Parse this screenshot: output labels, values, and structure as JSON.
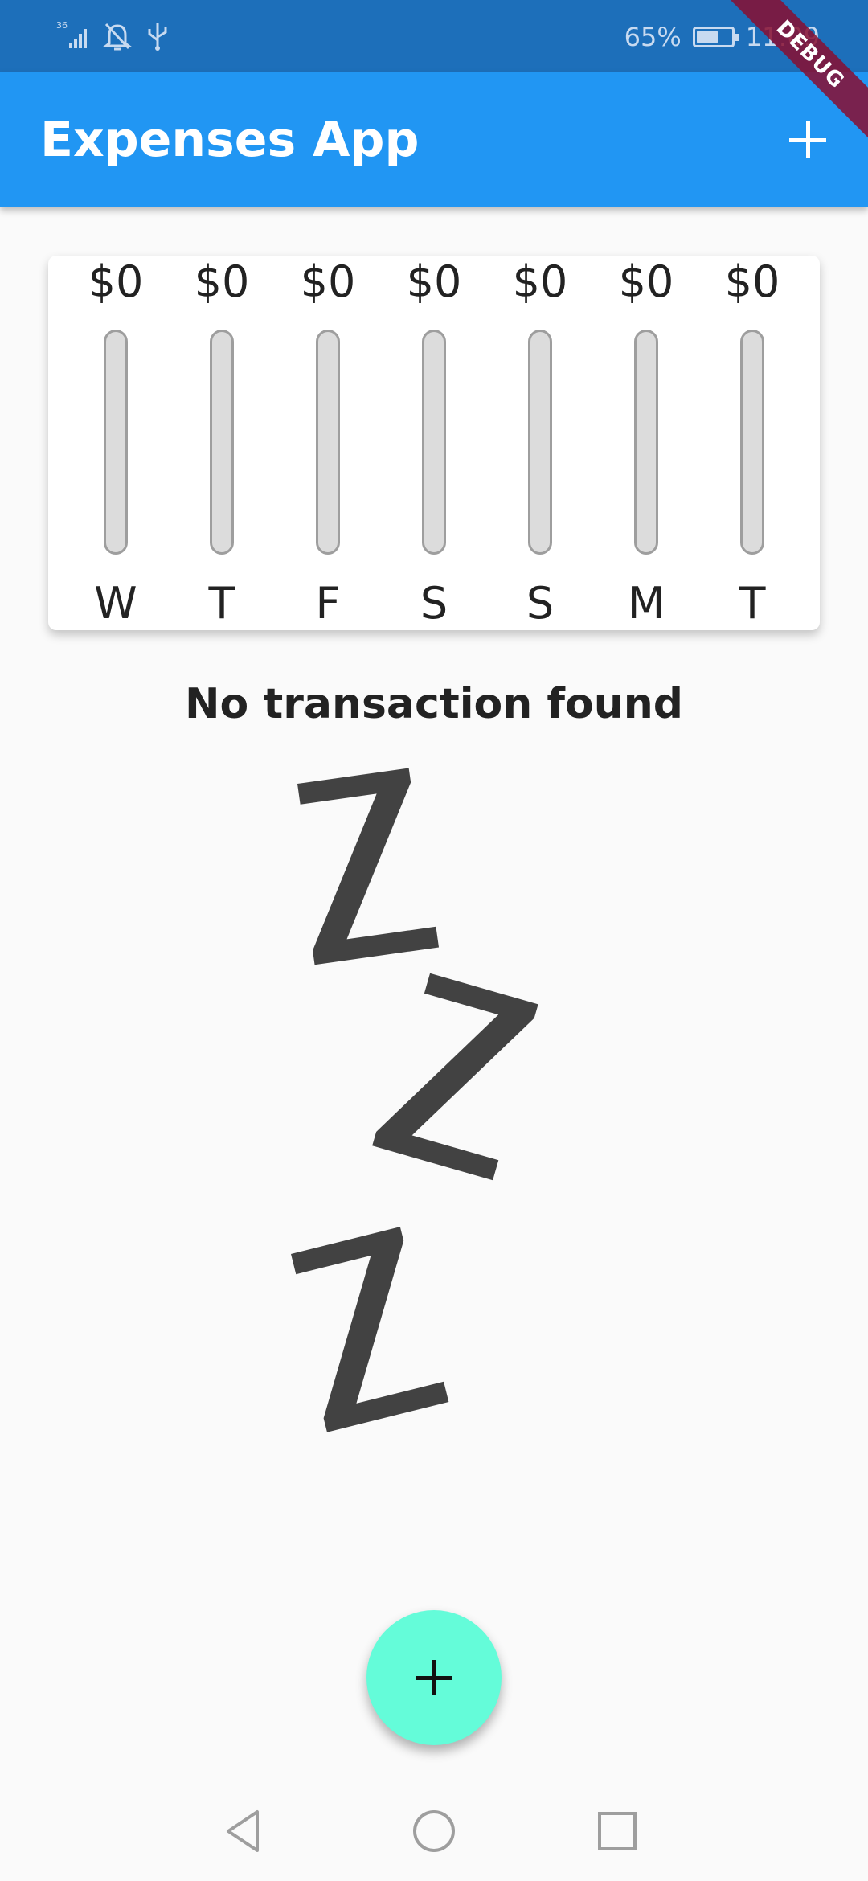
{
  "status_bar": {
    "network": "36",
    "battery_percent": "65%",
    "battery_level": 0.65,
    "time": "11:09",
    "icons": [
      "signal-icon",
      "mute-icon",
      "usb-icon",
      "battery-icon"
    ]
  },
  "debug_banner": "DEBUG",
  "app_bar": {
    "title": "Expenses App",
    "add_icon": "plus-icon"
  },
  "chart": {
    "days": [
      {
        "label": "W",
        "amount": "$0",
        "fraction": 0
      },
      {
        "label": "T",
        "amount": "$0",
        "fraction": 0
      },
      {
        "label": "F",
        "amount": "$0",
        "fraction": 0
      },
      {
        "label": "S",
        "amount": "$0",
        "fraction": 0
      },
      {
        "label": "S",
        "amount": "$0",
        "fraction": 0
      },
      {
        "label": "M",
        "amount": "$0",
        "fraction": 0
      },
      {
        "label": "T",
        "amount": "$0",
        "fraction": 0
      }
    ]
  },
  "empty_state": {
    "title": "No transaction found",
    "image": "sleeping-zzz-icon"
  },
  "fab": {
    "icon": "plus-icon"
  },
  "nav_bar": {
    "icons": [
      "back-icon",
      "home-icon",
      "recents-icon"
    ]
  },
  "colors": {
    "status_bar": "#1d6fba",
    "primary": "#2196f3",
    "accent": "#64fcd9",
    "background": "#fafafa",
    "bar_track": "#dcdcdc",
    "debug_banner": "#880e30",
    "zzz": "#424242"
  }
}
